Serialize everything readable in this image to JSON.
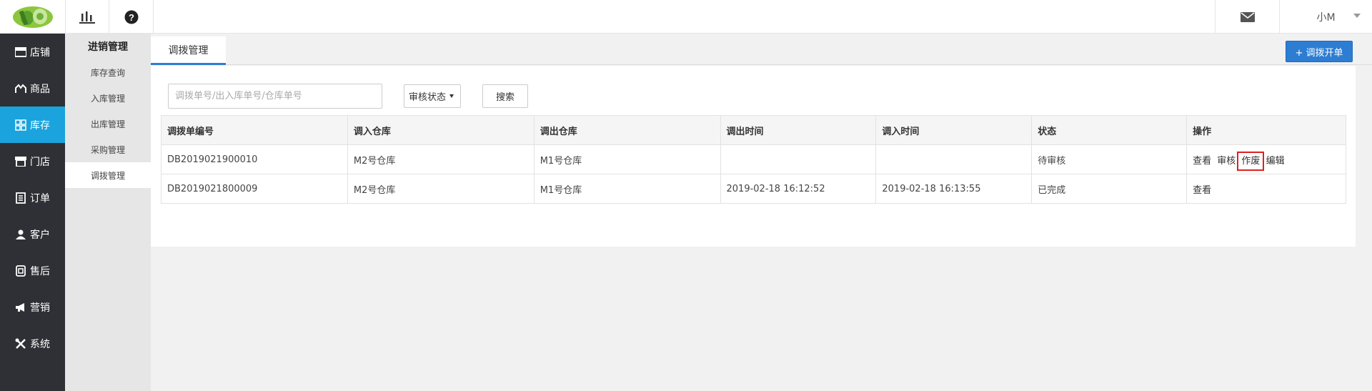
{
  "header": {
    "user_name": "小M",
    "icons": {
      "chart": "bar-chart-icon",
      "help": "help-circle-icon",
      "mail": "mail-icon"
    }
  },
  "sidebar": {
    "items": [
      {
        "label": "店铺",
        "icon": "store-icon"
      },
      {
        "label": "商品",
        "icon": "goods-icon"
      },
      {
        "label": "库存",
        "icon": "grid-icon",
        "active": true
      },
      {
        "label": "门店",
        "icon": "shop-icon"
      },
      {
        "label": "订单",
        "icon": "order-icon"
      },
      {
        "label": "客户",
        "icon": "user-icon"
      },
      {
        "label": "售后",
        "icon": "aftersale-icon"
      },
      {
        "label": "营销",
        "icon": "megaphone-icon"
      },
      {
        "label": "系统",
        "icon": "tools-icon"
      }
    ]
  },
  "subnav": {
    "title": "进销管理",
    "items": [
      "库存查询",
      "入库管理",
      "出库管理",
      "采购管理",
      "调拨管理"
    ]
  },
  "main": {
    "tab_label": "调拨管理",
    "new_button": "+ 调拨开单",
    "search": {
      "placeholder": "调拨单号/出入库单号/仓库单号",
      "status_select": "审核状态",
      "button": "搜索"
    },
    "table": {
      "headers": [
        "调拨单编号",
        "调入仓库",
        "调出仓库",
        "调出时间",
        "调入时间",
        "状态",
        "操作"
      ],
      "rows": [
        {
          "id": "DB2019021900010",
          "in_wh": "M2号仓库",
          "out_wh": "M1号仓库",
          "out_time": "",
          "in_time": "",
          "status": "待审核",
          "ops": [
            "查看",
            "审核",
            "作废",
            "编辑"
          ]
        },
        {
          "id": "DB2019021800009",
          "in_wh": "M2号仓库",
          "out_wh": "M1号仓库",
          "out_time": "2019-02-18 16:12:52",
          "in_time": "2019-02-18 16:13:55",
          "status": "已完成",
          "ops": [
            "查看"
          ]
        }
      ]
    }
  },
  "colors": {
    "sidebar_bg": "#2f3035",
    "sidebar_active": "#1aa3dd",
    "primary_button": "#2d7dd2",
    "highlight_box": "#e02020"
  }
}
